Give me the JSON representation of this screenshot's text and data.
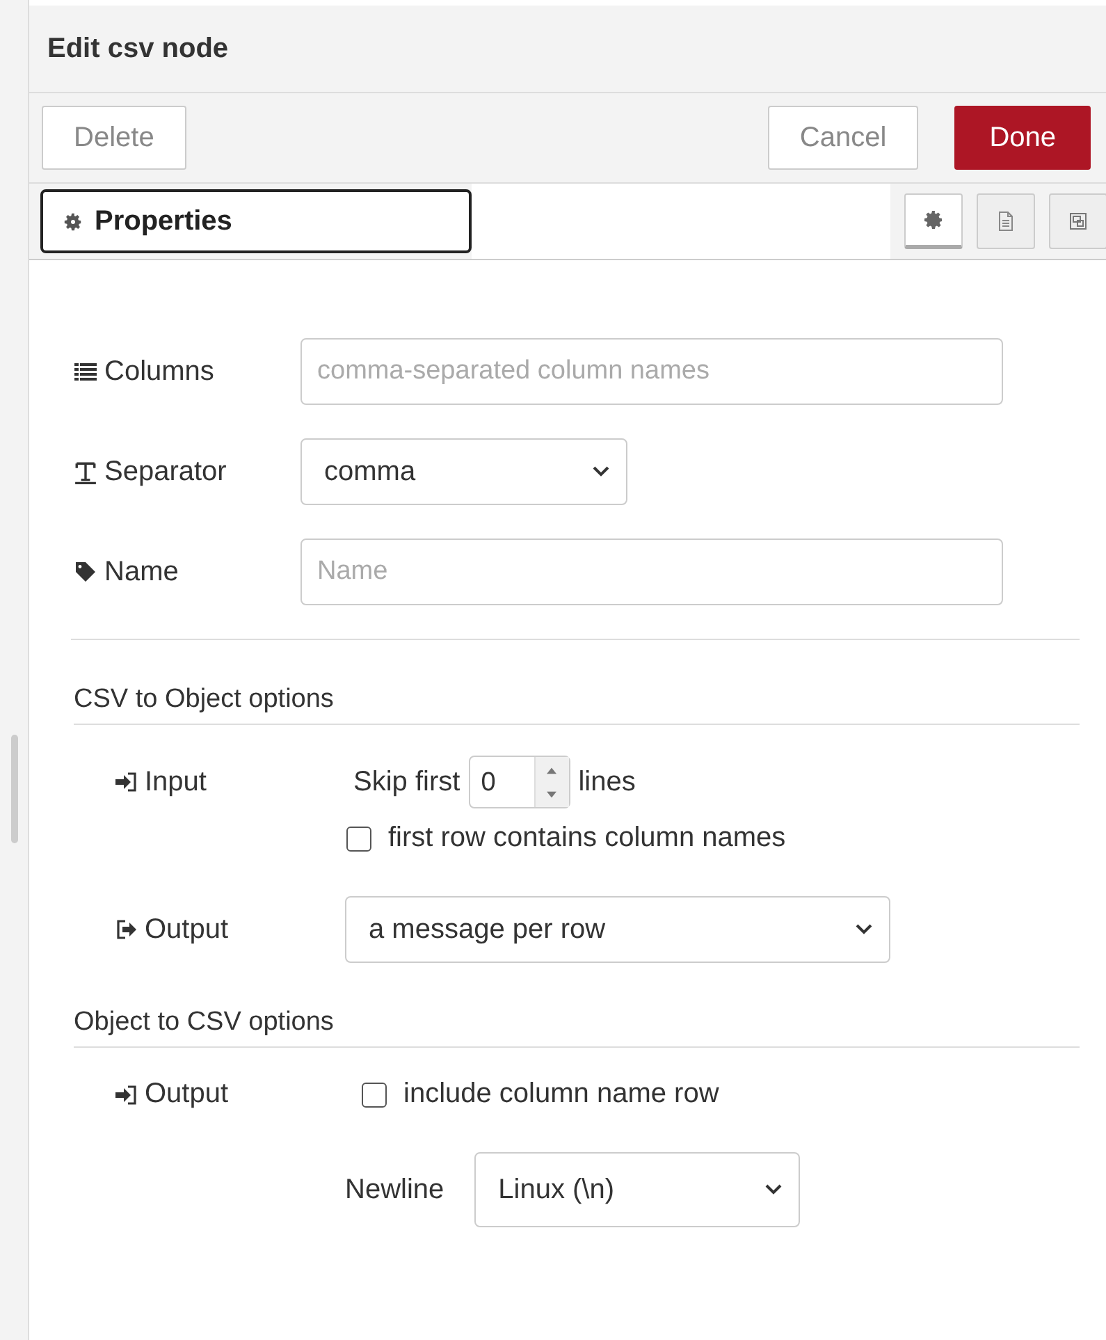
{
  "dialog": {
    "title": "Edit csv node"
  },
  "buttons": [
    {
      "label": "Delete",
      "kind": "secondary"
    },
    {
      "label": "Cancel",
      "kind": "secondary"
    },
    {
      "label": "Done",
      "kind": "primary"
    }
  ],
  "tabs": [
    {
      "label": "Properties",
      "selected": true
    }
  ],
  "tab_icons": [
    {
      "kind": "settings",
      "selected": true
    },
    {
      "kind": "description",
      "selected": false
    },
    {
      "kind": "appearance",
      "selected": false
    }
  ],
  "fields": [
    {
      "kind": "input",
      "label": "Columns",
      "placeholder": "comma-separated column names"
    },
    {
      "kind": "select",
      "label": "Separator",
      "value": "comma"
    },
    {
      "kind": "input",
      "label": "Name",
      "placeholder": "Name"
    }
  ],
  "csv_to_object": {
    "title": "CSV to Object options",
    "input_label": "Input",
    "skip_before": "Skip first",
    "skip_value": "0",
    "skip_after": "lines",
    "header_checkbox": {
      "label": "first row contains column names",
      "checked": false
    },
    "output_label": "Output",
    "output_value": "a message per row"
  },
  "object_to_csv": {
    "title": "Object to CSV options",
    "output_label": "Output",
    "header_checkbox": {
      "label": "include column name row",
      "checked": false
    },
    "newline_label": "Newline",
    "newline_value": "Linux (\\n)"
  }
}
